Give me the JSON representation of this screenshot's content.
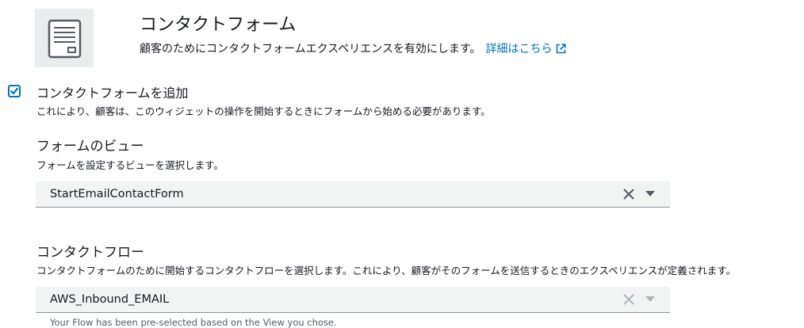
{
  "header": {
    "title": "コンタクトフォーム",
    "description": "顧客のためにコンタクトフォームエクスペリエンスを有効にします。",
    "link_label": "詳細はこちら",
    "icon": "form-document-icon"
  },
  "add_form": {
    "checked": true,
    "label": "コンタクトフォームを追加",
    "description": "これにより、顧客は、このウィジェットの操作を開始するときにフォームから始める必要があります。"
  },
  "form_view": {
    "label": "フォームのビュー",
    "description": "フォームを設定するビューを選択します。",
    "selected_value": "StartEmailContactForm"
  },
  "contact_flow": {
    "label": "コンタクトフロー",
    "description": "コンタクトフォームのために開始するコンタクトフローを選択します。これにより、顧客がそのフォームを送信するときのエクスペリエンスが定義されます。",
    "selected_value": "AWS_Inbound_EMAIL",
    "hint": "Your Flow has been pre-selected based on the View you chose."
  },
  "colors": {
    "accent": "#0073bb",
    "select_bg": "#f2f3f3",
    "icon_box_bg": "#eaeded"
  }
}
